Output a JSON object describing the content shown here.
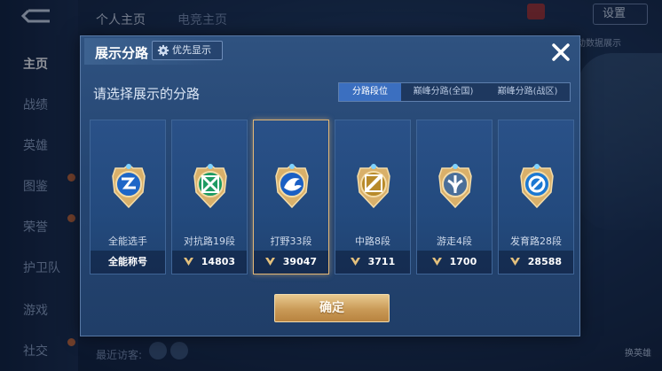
{
  "background": {
    "back_icon": "back-arrow-icon",
    "nav": [
      {
        "label": "主页",
        "active": true
      },
      {
        "label": "战绩",
        "active": false
      },
      {
        "label": "英雄",
        "active": false
      },
      {
        "label": "图鉴",
        "active": false
      },
      {
        "label": "荣誉",
        "active": false
      },
      {
        "label": "护卫队",
        "active": false
      },
      {
        "label": "游戏",
        "active": false
      },
      {
        "label": "社交",
        "active": false
      }
    ],
    "top_tabs": [
      "个人主页",
      "电竞主页"
    ],
    "settings_label": "设置",
    "right_hint": "动数据展示",
    "bottom_left": "最近访客:",
    "bottom_right": "换英雄"
  },
  "modal": {
    "title": "展示分路",
    "priority_label": "优先显示",
    "subtitle": "请选择展示的分路",
    "segments": [
      {
        "label": "分路段位",
        "active": true
      },
      {
        "label": "巅峰分路(全国)",
        "active": false
      },
      {
        "label": "巅峰分路(战区)",
        "active": false
      }
    ],
    "cards": [
      {
        "label": "全能选手",
        "footer": "全能称号",
        "has_score": false,
        "selected": false,
        "badge_color": "#1e66c7"
      },
      {
        "label": "对抗路19段",
        "footer": "14803",
        "has_score": true,
        "selected": false,
        "badge_color": "#1d9a62"
      },
      {
        "label": "打野33段",
        "footer": "39047",
        "has_score": true,
        "selected": true,
        "badge_color": "#1a5fc4"
      },
      {
        "label": "中路8段",
        "footer": "3711",
        "has_score": true,
        "selected": false,
        "badge_color": "#b88a2a"
      },
      {
        "label": "游走4段",
        "footer": "1700",
        "has_score": true,
        "selected": false,
        "badge_color": "#4a6f99"
      },
      {
        "label": "发育路28段",
        "footer": "28588",
        "has_score": true,
        "selected": false,
        "badge_color": "#1b78d2"
      }
    ],
    "confirm_label": "确定"
  },
  "colors": {
    "accent_gold": "#e3b776",
    "active_tab": "#3b6fc0"
  }
}
